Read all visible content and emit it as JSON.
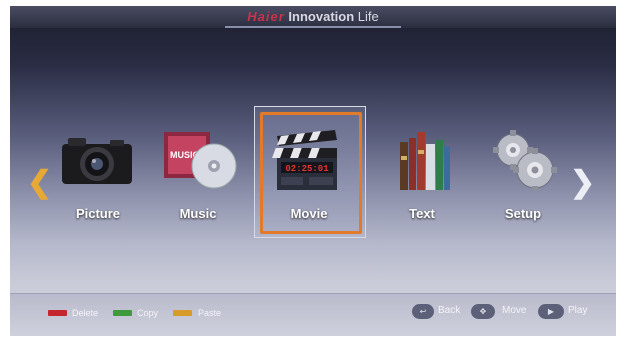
{
  "header": {
    "brand_main": "Haier",
    "brand_sub": "Innovation",
    "brand_tail": "Life"
  },
  "menu": {
    "items": [
      {
        "label": "Picture",
        "icon": "camera-icon"
      },
      {
        "label": "Music",
        "icon": "music-cd-icon"
      },
      {
        "label": "Movie",
        "icon": "clapperboard-icon",
        "selected": true
      },
      {
        "label": "Text",
        "icon": "books-icon"
      },
      {
        "label": "Setup",
        "icon": "gears-icon"
      }
    ],
    "clapper_time": "02:25:01",
    "selected_color": "#e27a2a"
  },
  "footer": {
    "actions": [
      {
        "label": "Delete",
        "color": "#c4252e"
      },
      {
        "label": "Copy",
        "color": "#3f9a3c"
      },
      {
        "label": "Paste",
        "color": "#d69b28"
      }
    ],
    "hints": [
      {
        "label": "Back"
      },
      {
        "label": "Move"
      },
      {
        "label": "Play"
      }
    ]
  }
}
